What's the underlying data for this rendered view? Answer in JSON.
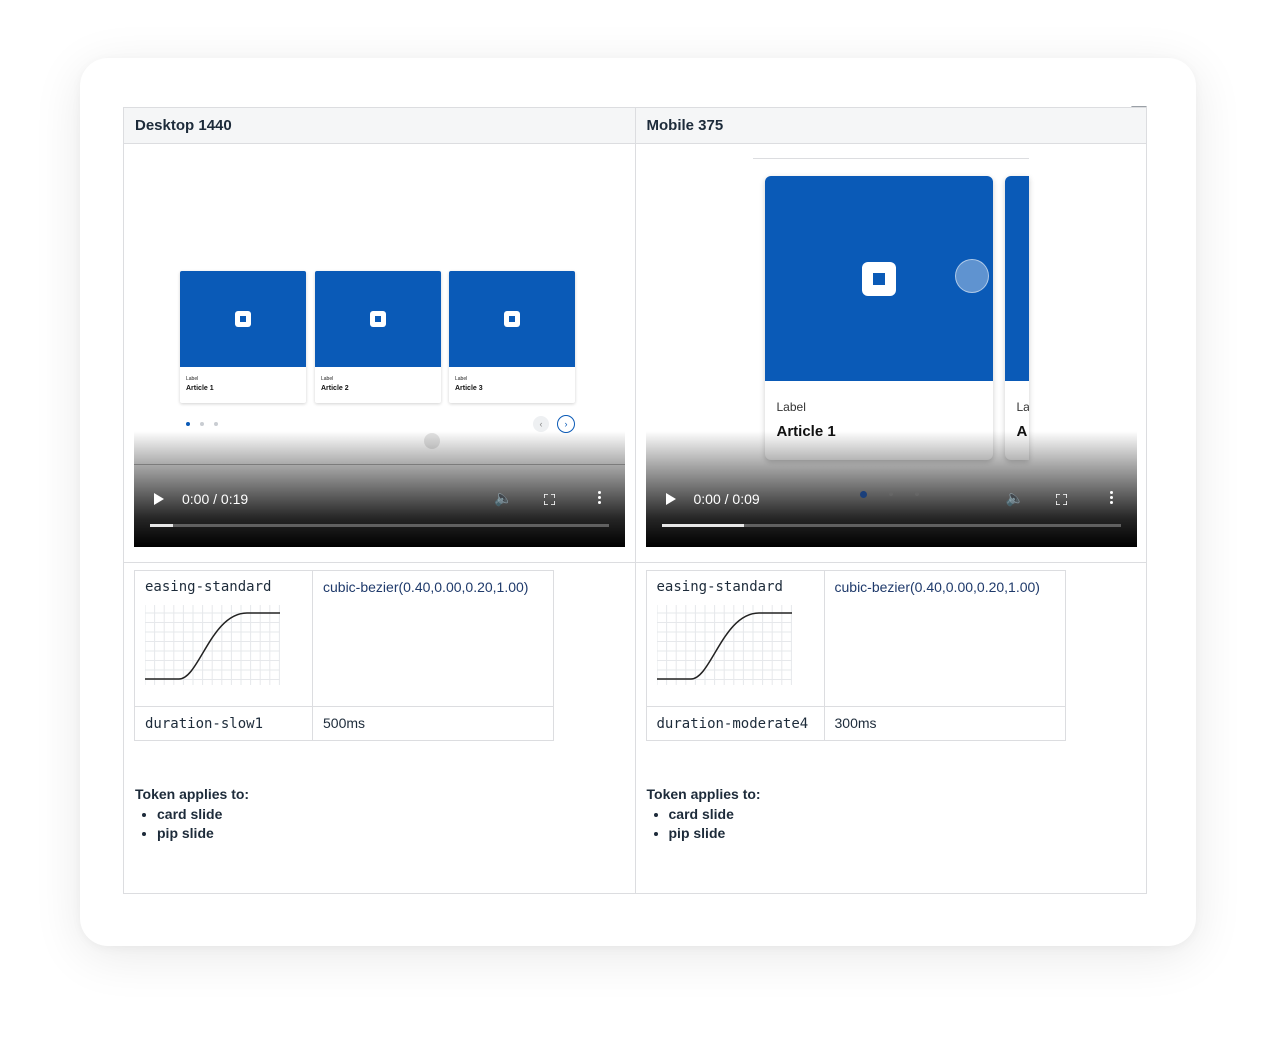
{
  "columns": [
    {
      "header": "Desktop 1440",
      "video": {
        "time": "0:00 / 0:19",
        "progress": 0.05
      },
      "preview": {
        "cards": [
          {
            "label": "Label",
            "title": "Article 1"
          },
          {
            "label": "Label",
            "title": "Article 2"
          },
          {
            "label": "Label",
            "title": "Article 3"
          }
        ]
      },
      "tokens": {
        "easing_name": "easing-standard",
        "easing_value": "cubic-bezier(0.40,0.00,0.20,1.00)",
        "duration_name": "duration-slow1",
        "duration_value": "500ms"
      },
      "applies_title": "Token applies to:",
      "applies": [
        "card slide",
        "pip slide"
      ]
    },
    {
      "header": "Mobile 375",
      "video": {
        "time": "0:00 / 0:09",
        "progress": 0.18
      },
      "preview": {
        "cards": [
          {
            "label": "Label",
            "title": "Article 1"
          },
          {
            "label": "La",
            "title": "A"
          }
        ]
      },
      "tokens": {
        "easing_name": "easing-standard",
        "easing_value": "cubic-bezier(0.40,0.00,0.20,1.00)",
        "duration_name": "duration-moderate4",
        "duration_value": "300ms"
      },
      "applies_title": "Token applies to:",
      "applies": [
        "card slide",
        "pip slide"
      ]
    }
  ],
  "colors": {
    "brand_blue": "#0a5ab7",
    "header_bg": "#f5f6f7",
    "border": "#dcdde0",
    "text": "#1d2b3a"
  },
  "icons": {
    "filter": "filter-icon",
    "play": "play-icon",
    "volume": "volume-icon",
    "fullscreen": "fullscreen-icon",
    "more": "more-options-icon"
  }
}
